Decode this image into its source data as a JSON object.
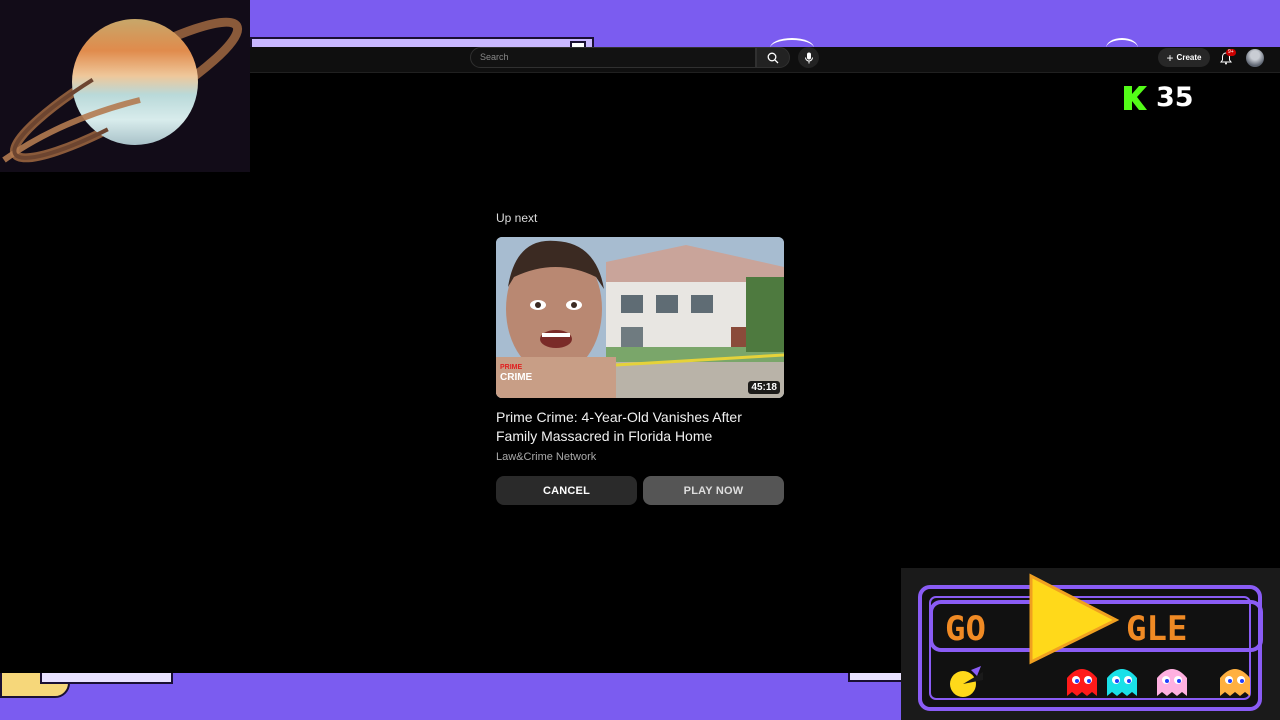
{
  "topbar": {
    "search_placeholder": "Search",
    "create_label": "Create",
    "notification_badge": "9+"
  },
  "game": {
    "score": "35"
  },
  "up_next": {
    "label": "Up next",
    "duration": "45:18",
    "thumbnail_logo_line1": "PRIME",
    "thumbnail_logo_line2": "CRIME",
    "title_line1": "Prime Crime: 4-Year-Old Vanishes After",
    "title_line2": "Family Massacred in Florida Home",
    "channel": "Law&Crime Network",
    "cancel_label": "CANCEL",
    "play_label": "PLAY NOW"
  },
  "doodle": {
    "letters_left": "GO",
    "letters_right": "GLE"
  },
  "colors": {
    "desktop_bg": "#7b5cf0",
    "player_bg": "#000000",
    "doodle_orange": "#f08a24",
    "doodle_purple": "#8a5cf5",
    "pacman_yellow": "#ffd91a"
  }
}
